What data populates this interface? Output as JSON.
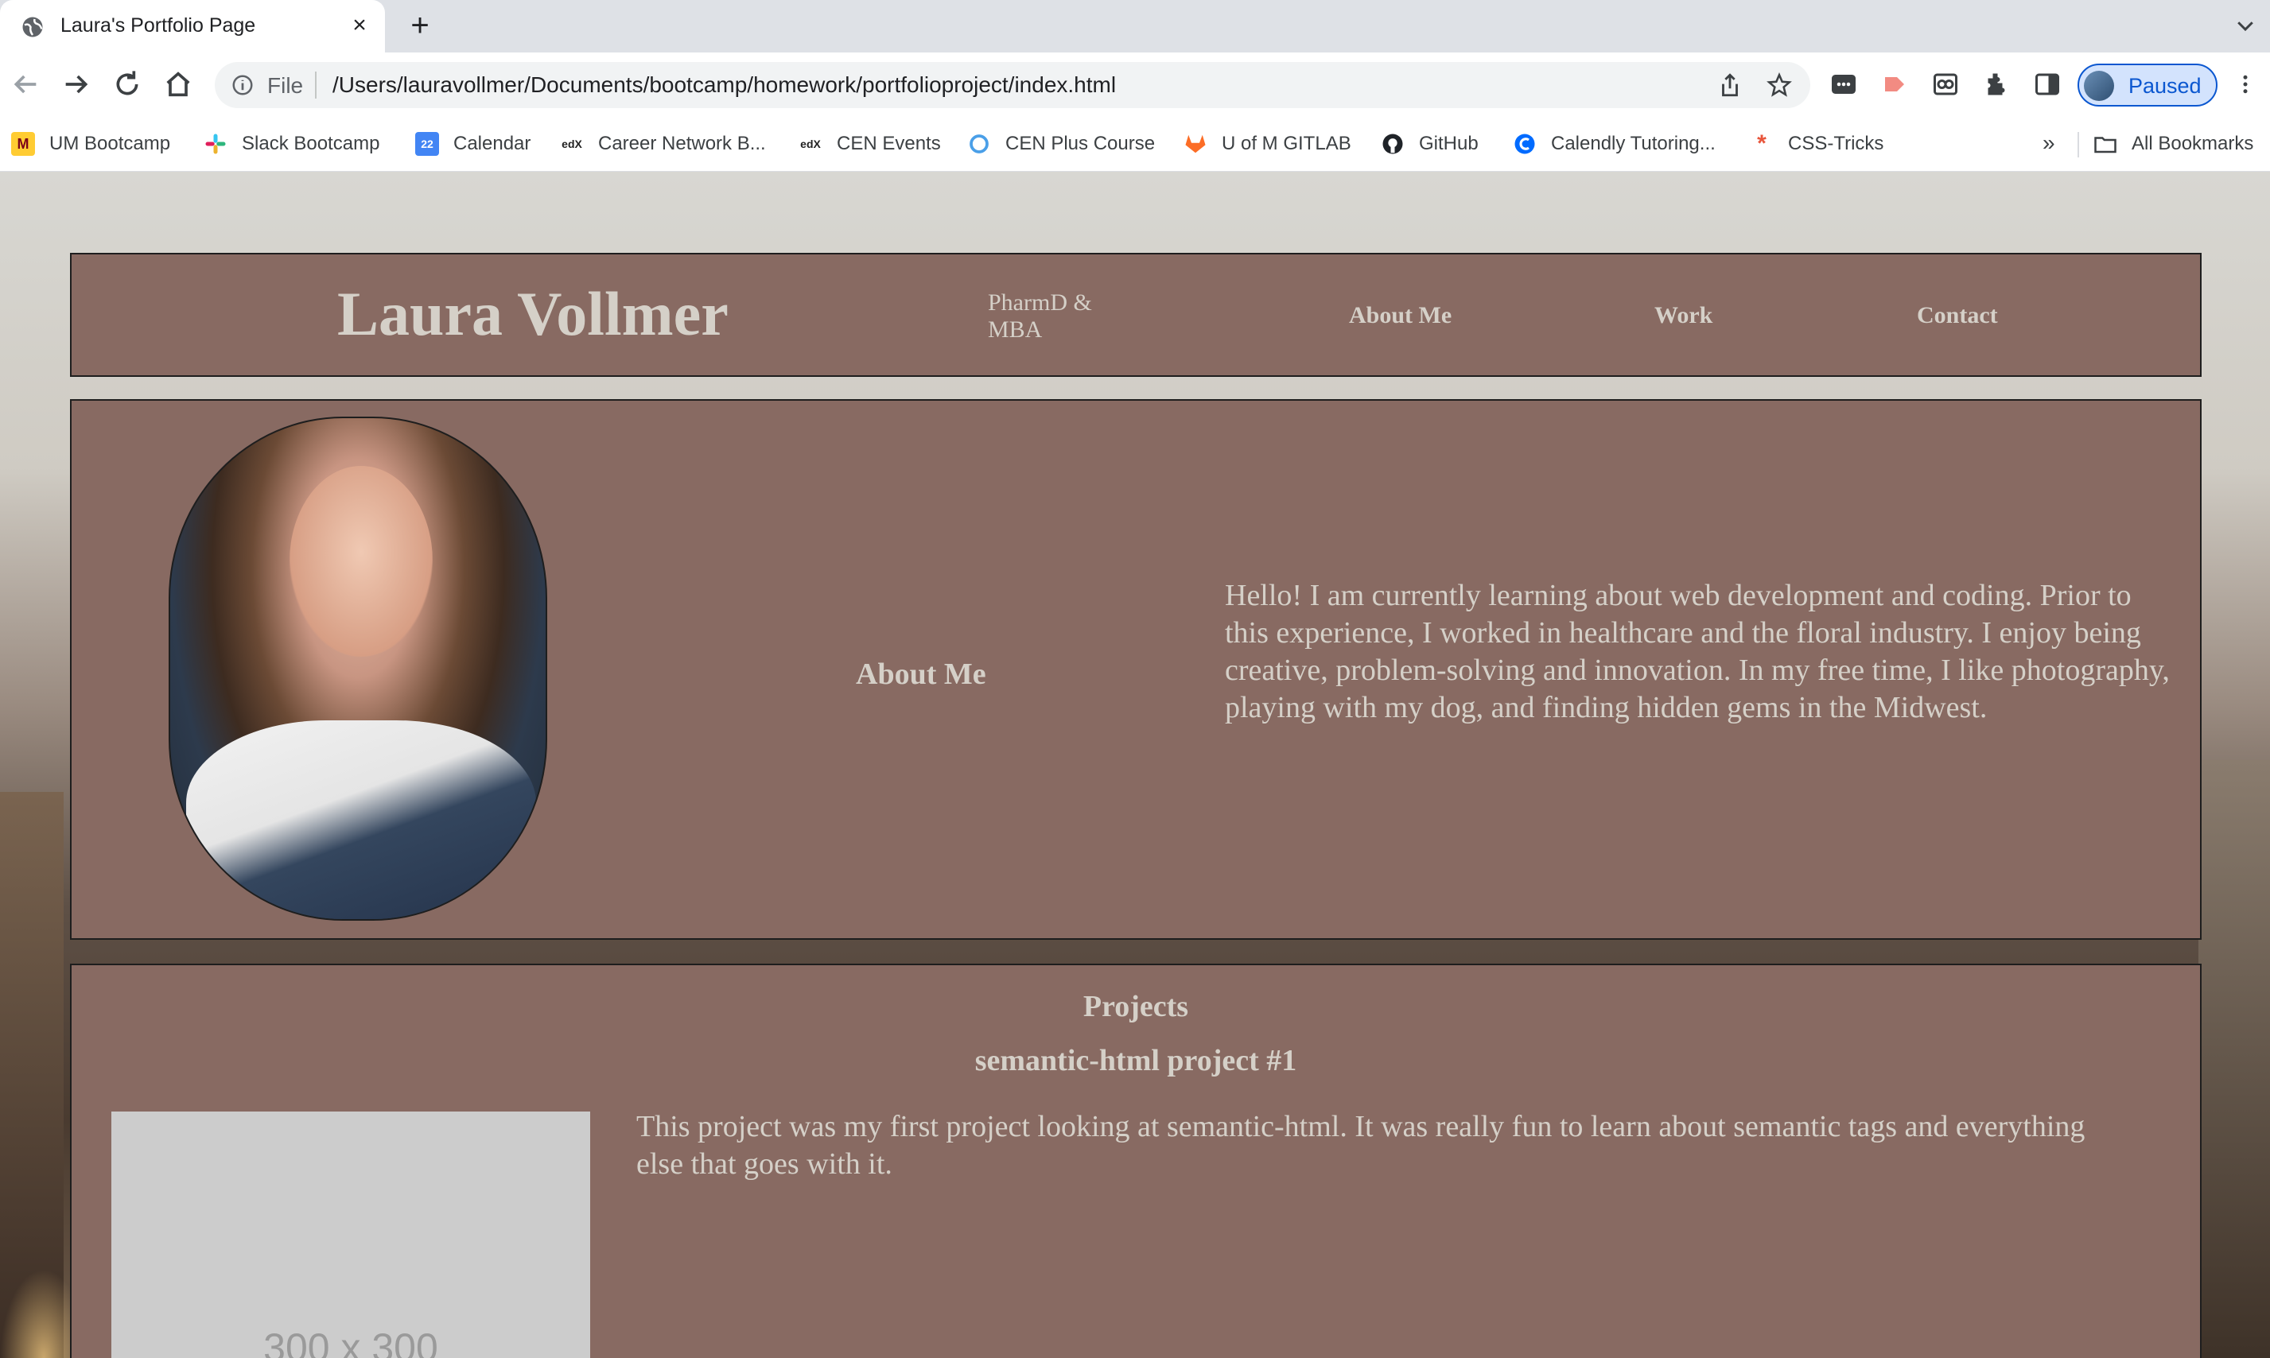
{
  "browser": {
    "tab_title": "Laura's Portfolio Page",
    "omnibox_scheme": "File",
    "url": "/Users/lauravollmer/Documents/bootcamp/homework/portfolioproject/index.html",
    "profile_status": "Paused",
    "bookmarks": [
      {
        "label": "UM Bootcamp",
        "icon": "umn-icon"
      },
      {
        "label": "Slack Bootcamp",
        "icon": "slack-icon"
      },
      {
        "label": "Calendar",
        "icon": "google-calendar-icon"
      },
      {
        "label": "Career Network B...",
        "icon": "edx-icon"
      },
      {
        "label": "CEN Events",
        "icon": "edx-icon"
      },
      {
        "label": "CEN Plus Course",
        "icon": "circle-icon"
      },
      {
        "label": "U of M GITLAB",
        "icon": "gitlab-icon"
      },
      {
        "label": "GitHub",
        "icon": "github-icon"
      },
      {
        "label": "Calendly Tutoring...",
        "icon": "calendly-icon"
      },
      {
        "label": "CSS-Tricks",
        "icon": "css-tricks-icon"
      }
    ],
    "bookmarks_overflow": "»",
    "all_bookmarks_label": "All Bookmarks",
    "accent_color": "#0b57d0"
  },
  "page": {
    "site_title": "Laura Vollmer",
    "subtitle": "PharmD & MBA",
    "nav": [
      "About Me",
      "Work",
      "Contact"
    ],
    "about": {
      "heading": "About Me",
      "text": "Hello! I am currently learning about web development and coding. Prior to this experience, I worked in healthcare and the floral industry. I enjoy being creative, problem-solving and innovation. In my free time, I like photography, playing with my dog, and finding hidden gems in the Midwest."
    },
    "projects": {
      "heading": "Projects",
      "items": [
        {
          "title": "semantic-html project #1",
          "image_text": "300 x 300",
          "description": "This project was my first project looking at semantic-html. It was really fun to learn about semantic tags and everything else that goes with it."
        }
      ]
    },
    "colors": {
      "panel": "#886a62",
      "text": "#d5d0c8",
      "border": "#1e1e1e"
    }
  }
}
